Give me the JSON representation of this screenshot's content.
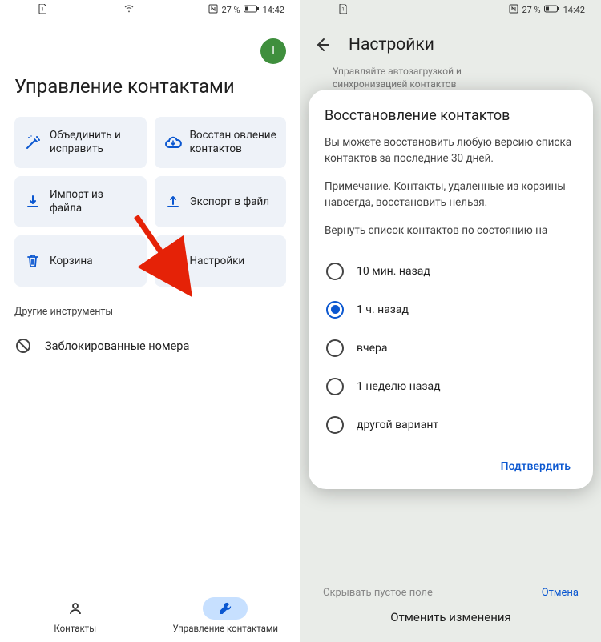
{
  "statusbar": {
    "battery": "27 %",
    "time": "14:42"
  },
  "left": {
    "avatar_letter": "I",
    "title": "Управление контактами",
    "tiles": [
      {
        "label": "Объединить и исправить"
      },
      {
        "label": "Восстан овление контактов"
      },
      {
        "label": "Импорт из файла"
      },
      {
        "label": "Экспорт в файл"
      },
      {
        "label": "Корзина"
      },
      {
        "label": "Настройки"
      }
    ],
    "section": "Другие инструменты",
    "blocked": "Заблокированные номера",
    "nav": {
      "contacts": "Контакты",
      "manage": "Управление контактами"
    }
  },
  "right": {
    "title": "Настройки",
    "dim_line1": "Управляйте автозагрузкой и",
    "dim_line2": "синхронизацией контактов",
    "sheet": {
      "title": "Восстановление контактов",
      "p1": "Вы можете восстановить любую версию списка контактов за последние 30 дней.",
      "p2": "Примечание. Контакты, удаленные из корзины навсегда, восстановить нельзя.",
      "p3": "Вернуть список контактов по состоянию на",
      "options": [
        "10 мин. назад",
        "1 ч. назад",
        "вчера",
        "1 неделю назад",
        "другой вариант"
      ],
      "confirm": "Подтвердить"
    },
    "below_hidden": "Скрывать пустое поле",
    "cancel": "Отмена",
    "undo": "Отменить изменения"
  }
}
